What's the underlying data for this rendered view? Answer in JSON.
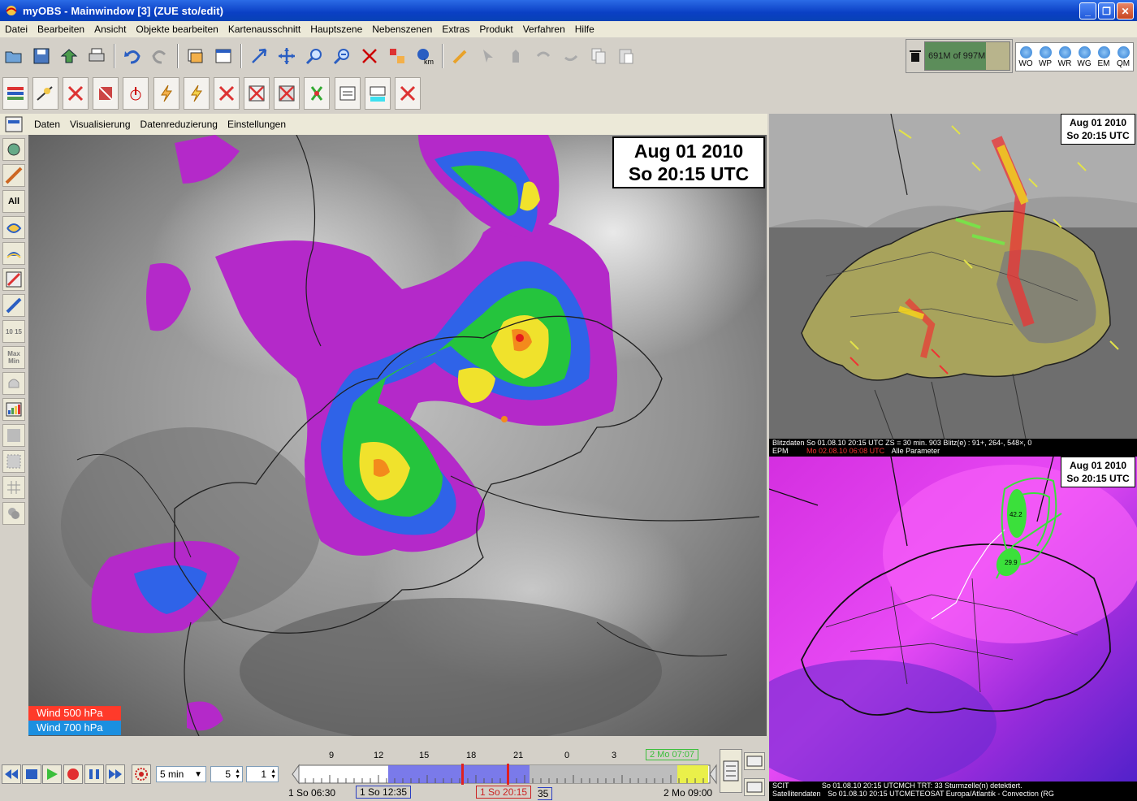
{
  "window": {
    "title": "myOBS - Mainwindow [3] (ZUE sto/edit)",
    "minimize": "_",
    "restore": "❐",
    "close": "✕"
  },
  "menu": [
    "Datei",
    "Bearbeiten",
    "Ansicht",
    "Objekte bearbeiten",
    "Kartenausschnitt",
    "Hauptszene",
    "Nebenszenen",
    "Extras",
    "Produkt",
    "Verfahren",
    "Hilfe"
  ],
  "memory": {
    "label": "691M of 997M",
    "used_fraction": 0.69
  },
  "stations": [
    "WO",
    "WP",
    "WR",
    "WG",
    "EM",
    "QM"
  ],
  "submenu": [
    "Daten",
    "Visualisierung",
    "Datenreduzierung",
    "Einstellungen"
  ],
  "sidebar": {
    "all_label": "All",
    "max_label": "Max",
    "min_label": "Min",
    "num_label": "10 15"
  },
  "main_map": {
    "date": "Aug 01 2010",
    "time": "So 20:15 UTC",
    "legend": [
      {
        "label": "Wind 500 hPa",
        "color": "#ff3a2a"
      },
      {
        "label": "Wind 700 hPa",
        "color": "#1b8fe0"
      }
    ]
  },
  "pane_lightning": {
    "date": "Aug 01 2010",
    "time": "So 20:15 UTC",
    "caption1": "Blitzdaten So 01.08.10 20:15 UTC ZS = 30 min. 903 Blitz(e) : 91+, 264-, 548×, 0",
    "caption2_prefix": "EPM",
    "caption2_red": "Mo 02.08.10 06:08 UTC",
    "caption2_suffix": "Alle Parameter"
  },
  "pane_satellite": {
    "date": "Aug 01 2010",
    "time": "So 20:15 UTC",
    "cell_labels": [
      "42.2",
      "29.9"
    ],
    "caption1_prefix": "SCIT",
    "caption1": "So 01.08.10 20:15 UTCMCH TRT: 33 Sturmzelle(n) detektiert.",
    "caption2_prefix": "Satellitendaten",
    "caption2": "So 01.08.10 20:15 UTCMETEOSAT Europa/Atlantik - Convection (RG"
  },
  "timeline": {
    "step": "5 min",
    "spin1": "5",
    "spin2": "1",
    "hours": [
      "9",
      "12",
      "15",
      "18",
      "21",
      "0",
      "3"
    ],
    "top_right_label": "2 Mo 07:07",
    "start_label": "1 So 06:30",
    "window_start": "1 So 12:35",
    "current": "1 So 20:15",
    "current_suffix": "35",
    "end_label": "2 Mo 09:00"
  }
}
